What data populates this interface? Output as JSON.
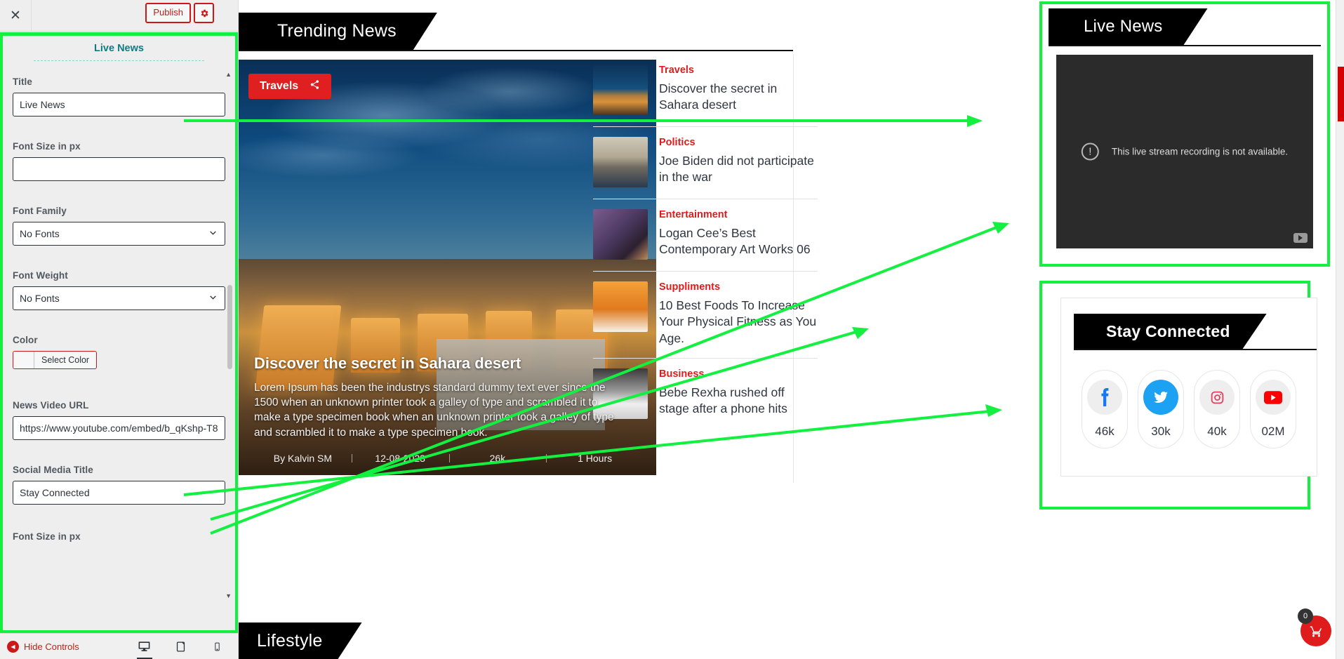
{
  "customizer": {
    "close_icon": "close-icon",
    "publish_label": "Publish",
    "gear_icon": "gear-icon",
    "panel_title": "Live News",
    "fields": [
      {
        "label": "Title",
        "value": "Live News",
        "type": "text"
      },
      {
        "label": "Font Size in px",
        "value": "",
        "type": "text"
      },
      {
        "label": "Font Family",
        "value": "No Fonts",
        "type": "select"
      },
      {
        "label": "Font Weight",
        "value": "No Fonts",
        "type": "select"
      },
      {
        "label": "Color",
        "value": "Select Color",
        "type": "color"
      },
      {
        "label": "News Video URL",
        "value": "https://www.youtube.com/embed/b_qKshp-T8",
        "type": "text"
      },
      {
        "label": "Social Media Title",
        "value": "Stay Connected",
        "type": "text"
      },
      {
        "label": "Font Size in px",
        "value": "",
        "type": "text"
      }
    ],
    "footer": {
      "hide_controls_label": "Hide Controls",
      "devices": [
        {
          "name": "desktop-view-icon",
          "active": true
        },
        {
          "name": "tablet-view-icon",
          "active": false
        },
        {
          "name": "mobile-view-icon",
          "active": false
        }
      ]
    }
  },
  "preview": {
    "trending": {
      "banner_title": "Trending News",
      "hero": {
        "category_badge": "Travels",
        "share_icon": "share-icon",
        "title": "Discover the secret in Sahara desert",
        "description": "Lorem Ipsum has been the industrys standard dummy text ever since the 1500 when an unknown printer took a galley of type and scrambled it to make a type specimen book when an unknown printer took a galley of type and scrambled it to make a type specimen book.",
        "meta": [
          "By Kalvin SM",
          "12-08-2023",
          "26k",
          "1 Hours"
        ]
      },
      "items": [
        {
          "category": "Travels",
          "title": "Discover the secret in Sahara desert",
          "thumb": "desert"
        },
        {
          "category": "Politics",
          "title": "Joe Biden did not participate in the war",
          "thumb": "politics"
        },
        {
          "category": "Entertainment",
          "title": "Logan Cee’s Best Contemporary Art Works 06",
          "thumb": "art"
        },
        {
          "category": "Suppliments",
          "title": "10 Best Foods To Increase Your Physical Fitness as You Age.",
          "thumb": "supplements"
        },
        {
          "category": "Business",
          "title": "Bebe Rexha rushed off stage after a phone hits",
          "thumb": "business"
        }
      ]
    },
    "live_news": {
      "banner_title": "Live News",
      "player_message": "This live stream recording is not available.",
      "warning_icon": "warning-circle-icon",
      "youtube_icon": "youtube-icon"
    },
    "social": {
      "banner_title": "Stay Connected",
      "items": [
        {
          "network": "facebook-icon",
          "count": "46k",
          "color": "#1877f2",
          "bg": "#eeeeee"
        },
        {
          "network": "twitter-icon",
          "count": "30k",
          "color": "#ffffff",
          "bg": "#1da1f2"
        },
        {
          "network": "instagram-icon",
          "count": "40k",
          "color": "#e4405f",
          "bg": "#eeeeee"
        },
        {
          "network": "youtube-icon",
          "count": "02M",
          "color": "#ff0000",
          "bg": "#eeeeee"
        }
      ]
    },
    "lifestyle_banner": "Lifestyle",
    "edit_fab_icon": "pencil-icon",
    "cart": {
      "icon": "cart-icon",
      "badge": "0"
    }
  },
  "colors": {
    "accent_red": "#e01b1b",
    "annotation_green": "#13f03f",
    "banner_black": "#000000",
    "customizer_teal": "#107b84"
  }
}
